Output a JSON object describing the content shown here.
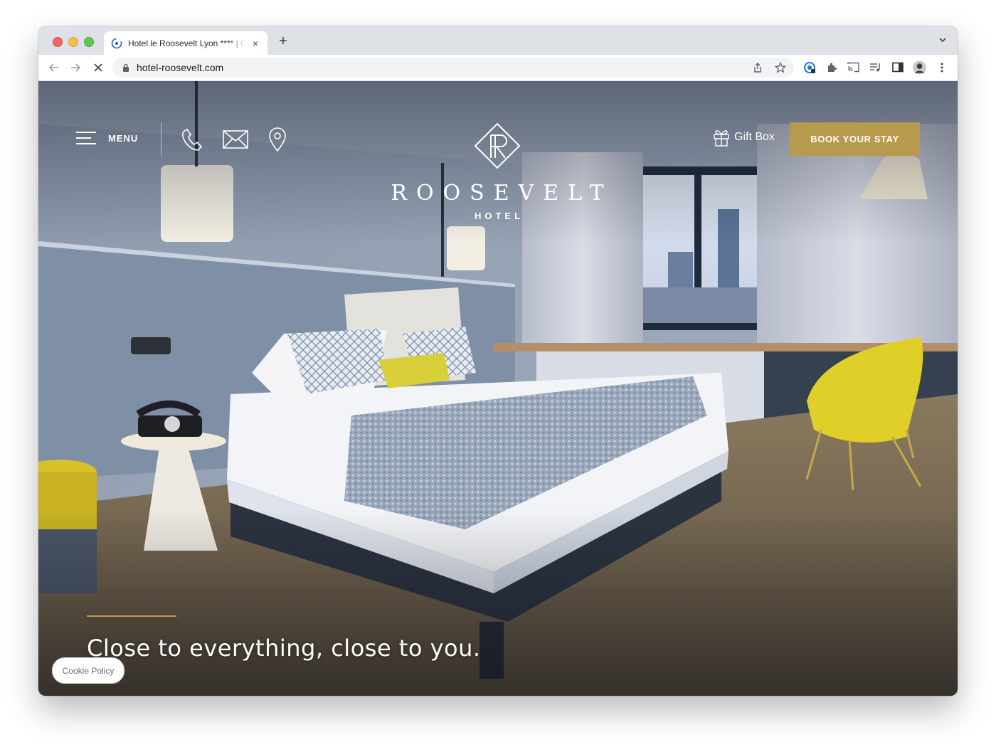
{
  "browser": {
    "tab_title": "Hotel le Roosevelt Lyon **** | C",
    "tab_close": "×",
    "new_tab": "+",
    "url": "hotel-roosevelt.com"
  },
  "site": {
    "menu_label": "MENU",
    "logo_word": "ROOSEVELT",
    "logo_sub": "HOTEL",
    "gift_label": "Gift Box",
    "book_label": "BOOK YOUR STAY",
    "tagline": "Close to everything, close to you.",
    "cookie_label": "Cookie Policy"
  },
  "colors": {
    "accent_gold": "#b89a4e",
    "browser_chrome": "#dee1e6"
  },
  "icons": [
    "menu-icon",
    "phone-icon",
    "mail-icon",
    "location-pin-icon",
    "gift-icon",
    "back-arrow-icon",
    "forward-arrow-icon",
    "stop-icon",
    "lock-icon",
    "share-icon",
    "star-icon",
    "extensions-icon",
    "cast-icon",
    "media-icon",
    "side-panel-icon",
    "profile-avatar",
    "kebab-menu-icon"
  ]
}
